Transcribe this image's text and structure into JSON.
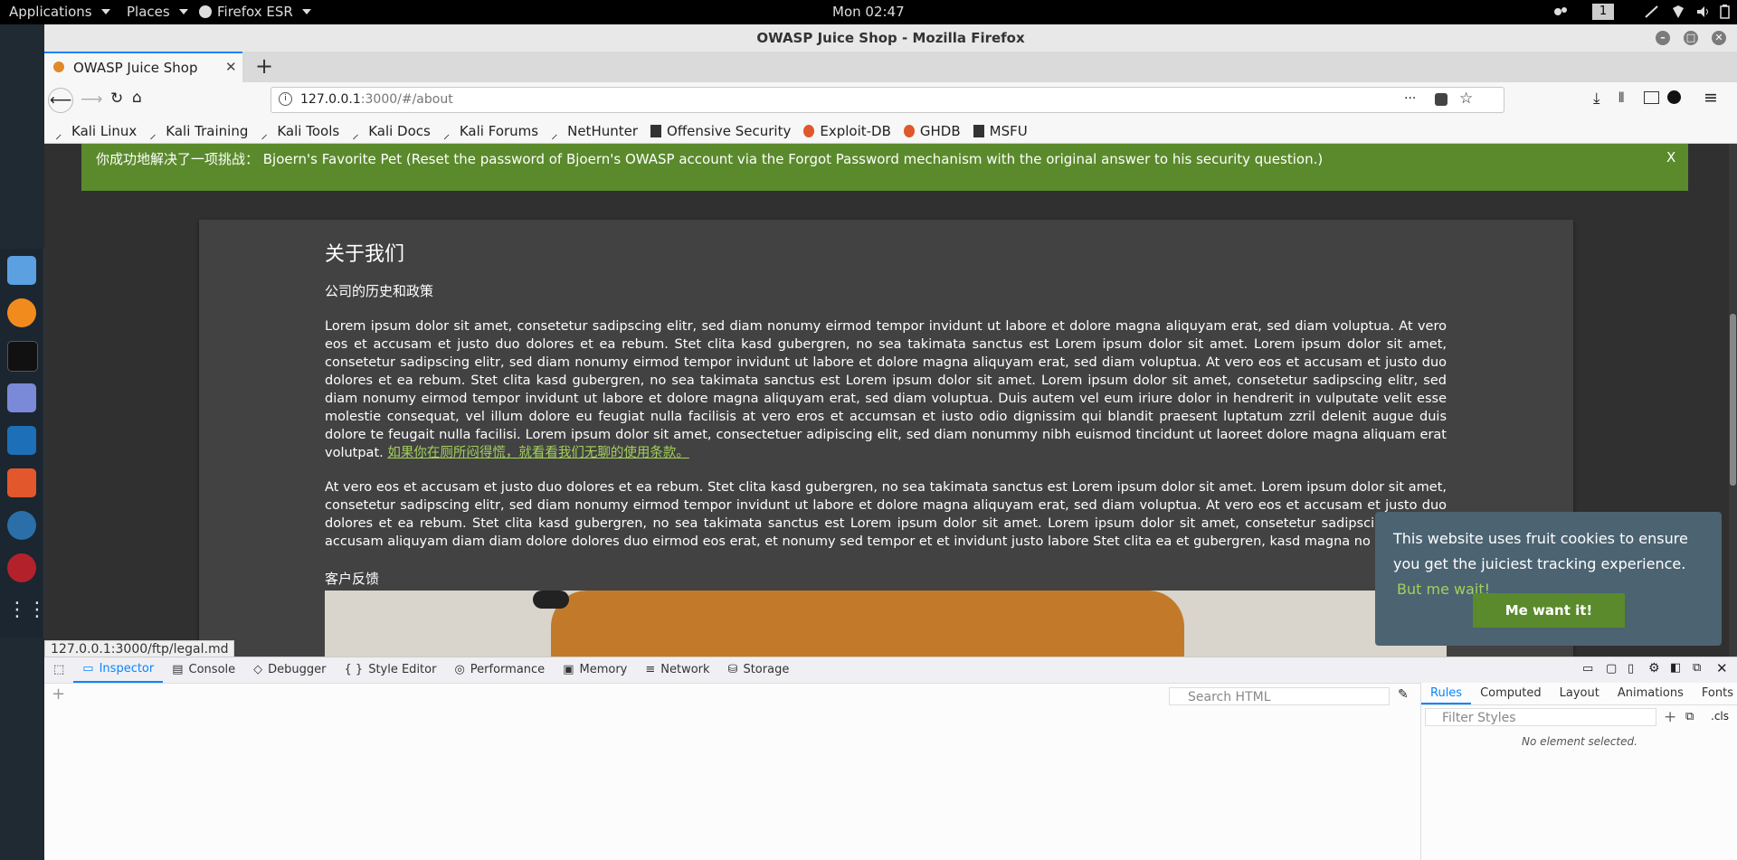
{
  "topbar": {
    "applications": "Applications",
    "places": "Places",
    "browser": "Firefox ESR",
    "clock": "Mon 02:47",
    "workspace": "1"
  },
  "window": {
    "title": "OWASP Juice Shop - Mozilla Firefox"
  },
  "tabs": [
    {
      "label": "OWASP Juice Shop",
      "close": "✕"
    }
  ],
  "newtab": "+",
  "urlbar": {
    "host": "127.0.0.1",
    "path": ":3000/#/about",
    "more": "···"
  },
  "bookmarks": [
    {
      "label": "Kali Linux",
      "icon": "kali-dragon-icon"
    },
    {
      "label": "Kali Training",
      "icon": "kali-dragon-icon"
    },
    {
      "label": "Kali Tools",
      "icon": "kali-dragon-icon"
    },
    {
      "label": "Kali Docs",
      "icon": "kali-dragon-icon"
    },
    {
      "label": "Kali Forums",
      "icon": "kali-dragon-icon"
    },
    {
      "label": "NetHunter",
      "icon": "kali-dragon-icon"
    },
    {
      "label": "Offensive Security",
      "icon": "offsec-icon"
    },
    {
      "label": "Exploit-DB",
      "icon": "exploitdb-icon"
    },
    {
      "label": "GHDB",
      "icon": "exploitdb-icon"
    },
    {
      "label": "MSFU",
      "icon": "offsec-icon"
    }
  ],
  "notification": {
    "text": "你成功地解决了一项挑战： Bjoern's Favorite Pet (Reset the password of Bjoern's OWASP account via the Forgot Password mechanism with the original answer to his security question.)",
    "close": "X",
    "color": "#5a8a2c"
  },
  "about": {
    "title": "关于我们",
    "history_heading": "公司的历史和政策",
    "paragraph1": "Lorem ipsum dolor sit amet, consetetur sadipscing elitr, sed diam nonumy eirmod tempor invidunt ut labore et dolore magna aliquyam erat, sed diam voluptua. At vero eos et accusam et justo duo dolores et ea rebum. Stet clita kasd gubergren, no sea takimata sanctus est Lorem ipsum dolor sit amet. Lorem ipsum dolor sit amet, consetetur sadipscing elitr, sed diam nonumy eirmod tempor invidunt ut labore et dolore magna aliquyam erat, sed diam voluptua. At vero eos et accusam et justo duo dolores et ea rebum. Stet clita kasd gubergren, no sea takimata sanctus est Lorem ipsum dolor sit amet. Lorem ipsum dolor sit amet, consetetur sadipscing elitr, sed diam nonumy eirmod tempor invidunt ut labore et dolore magna aliquyam erat, sed diam voluptua. Duis autem vel eum iriure dolor in hendrerit in vulputate velit esse molestie consequat, vel illum dolore eu feugiat nulla facilisis at vero eros et accumsan et iusto odio dignissim qui blandit praesent luptatum zzril delenit augue duis dolore te feugait nulla facilisi. Lorem ipsum dolor sit amet, consectetuer adipiscing elit, sed diam nonummy nibh euismod tincidunt ut laoreet dolore magna aliquam erat volutpat.",
    "legal_link": "如果你在厕所闷得慌，就看看我们无聊的使用条款。",
    "paragraph2": "At vero eos et accusam et justo duo dolores et ea rebum. Stet clita kasd gubergren, no sea takimata sanctus est Lorem ipsum dolor sit amet. Lorem ipsum dolor sit amet, consetetur sadipscing elitr, sed diam nonumy eirmod tempor invidunt ut labore et dolore magna aliquyam erat, sed diam voluptua. At vero eos et accusam et justo duo dolores et ea rebum. Stet clita kasd gubergren, no sea takimata sanctus est Lorem ipsum dolor sit amet. Lorem ipsum dolor sit amet, consetetur sadipscing elitr, At accusam aliquyam diam diam dolore dolores duo eirmod eos erat, et nonumy sed tempor et et invidunt justo labore Stet clita ea et gubergren, kasd magna no rebum.",
    "feedback_heading": "客户反馈"
  },
  "cookie": {
    "message": "This website uses fruit cookies to ensure you get the juiciest tracking experience.",
    "learn_more": "But me wait!",
    "accept": "Me want it!"
  },
  "status_url": "127.0.0.1:3000/ftp/legal.md",
  "devtools": {
    "tabs": [
      "Inspector",
      "Console",
      "Debugger",
      "Style Editor",
      "Performance",
      "Memory",
      "Network",
      "Storage"
    ],
    "search_placeholder": "Search HTML",
    "side_tabs": [
      "Rules",
      "Computed",
      "Layout",
      "Animations",
      "Fonts"
    ],
    "filter_placeholder": "Filter Styles",
    "cls": ".cls",
    "add": "+",
    "empty": "No element selected."
  }
}
